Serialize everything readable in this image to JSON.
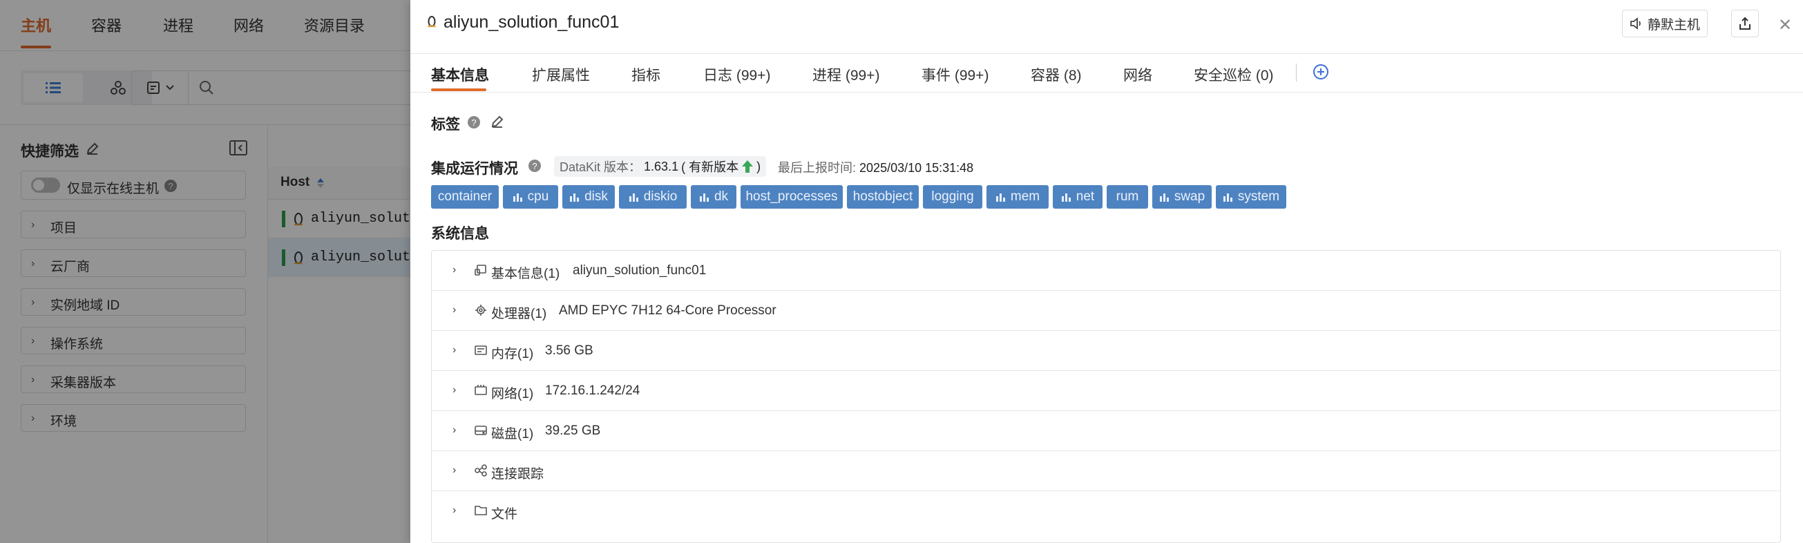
{
  "topnav": {
    "tabs": [
      "主机",
      "容器",
      "进程",
      "网络",
      "资源目录"
    ],
    "active": 0,
    "accent": "#e06b2c"
  },
  "sidebar": {
    "title": "快捷筛选",
    "online_only_label": "仅显示在线主机",
    "filters": [
      "项目",
      "云厂商",
      "实例地域 ID",
      "操作系统",
      "采集器版本",
      "环境"
    ]
  },
  "table": {
    "header": "Host",
    "rows": [
      "aliyun_soluti",
      "aliyun_soluti"
    ]
  },
  "drawer": {
    "title": "aliyun_solution_func01",
    "mute_label": "静默主机",
    "tabs": [
      "基本信息",
      "扩展属性",
      "指标",
      "日志 (99+)",
      "进程 (99+)",
      "事件 (99+)",
      "容器 (8)",
      "网络",
      "安全巡检 (0)"
    ],
    "tags_label": "标签",
    "integration": {
      "label": "集成运行情况",
      "datakit_label": "DataKit 版本：",
      "datakit_version": "1.63.1",
      "new_version_open": "( 有新版本",
      "new_version_close": ")",
      "last_report_label": "最后上报时间:",
      "last_report_value": "2025/03/10 15:31:48",
      "chip_color": "#4e83c1",
      "chips": [
        {
          "label": "container",
          "icon": false
        },
        {
          "label": "cpu",
          "icon": true
        },
        {
          "label": "disk",
          "icon": true
        },
        {
          "label": "diskio",
          "icon": true
        },
        {
          "label": "dk",
          "icon": true
        },
        {
          "label": "host_processes",
          "icon": false
        },
        {
          "label": "hostobject",
          "icon": false
        },
        {
          "label": "logging",
          "icon": false
        },
        {
          "label": "mem",
          "icon": true
        },
        {
          "label": "net",
          "icon": true
        },
        {
          "label": "rum",
          "icon": false
        },
        {
          "label": "swap",
          "icon": true
        },
        {
          "label": "system",
          "icon": true
        }
      ]
    },
    "system": {
      "label": "系统信息",
      "rows": [
        {
          "icon": "host-icon",
          "label": "基本信息(1)",
          "value": "aliyun_solution_func01"
        },
        {
          "icon": "cpu-icon",
          "label": "处理器(1)",
          "value": "AMD EPYC 7H12 64-Core Processor"
        },
        {
          "icon": "memory-icon",
          "label": "内存(1)",
          "value": "3.56 GB"
        },
        {
          "icon": "network-icon",
          "label": "网络(1)",
          "value": "172.16.1.242/24"
        },
        {
          "icon": "disk-icon",
          "label": "磁盘(1)",
          "value": "39.25 GB"
        },
        {
          "icon": "connection-icon",
          "label": "连接跟踪",
          "value": ""
        },
        {
          "icon": "folder-icon",
          "label": "文件",
          "value": ""
        }
      ]
    }
  }
}
